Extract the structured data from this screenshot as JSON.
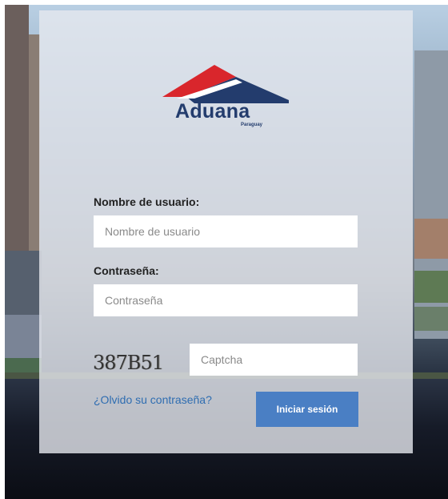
{
  "logo": {
    "brand": "Aduana",
    "country": "Paraguay"
  },
  "form": {
    "username_label": "Nombre de usuario:",
    "username_placeholder": "Nombre de usuario",
    "password_label": "Contraseña:",
    "password_placeholder": "Contraseña",
    "captcha_text": "387B51",
    "captcha_placeholder": "Captcha",
    "forgot_link": "¿Olvido su contraseña?",
    "login_button": "Iniciar sesión"
  },
  "colors": {
    "accent": "#4a7fc4",
    "link": "#2f6db1",
    "brand_red": "#d9262c",
    "brand_navy": "#233c6d"
  }
}
